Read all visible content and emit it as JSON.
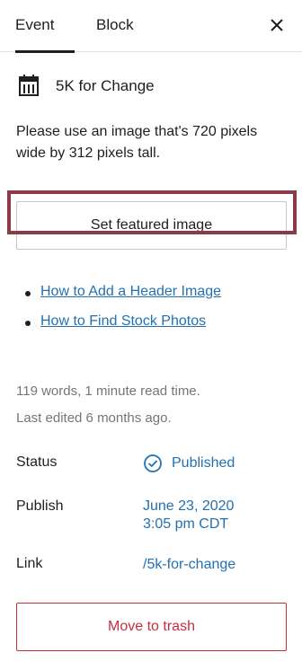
{
  "tabs": {
    "event": "Event",
    "block": "Block"
  },
  "post": {
    "title": "5K for Change"
  },
  "hint": "Please use an image that's 720 pixels wide by 312 pixels tall.",
  "featured_button": "Set featured image",
  "links": [
    "How to Add a Header Image",
    "How to Find Stock Photos"
  ],
  "meta": {
    "words": "119 words, 1 minute read time.",
    "edited": "Last edited 6 months ago."
  },
  "status": {
    "label": "Status",
    "value": "Published"
  },
  "publish": {
    "label": "Publish",
    "date": "June 23, 2020",
    "time": "3:05 pm CDT"
  },
  "link": {
    "label": "Link",
    "value": "/5k-for-change"
  },
  "trash_button": "Move to trash",
  "colors": {
    "link": "#2271b1",
    "danger": "#c72d3f",
    "highlight": "#8b3a46"
  }
}
